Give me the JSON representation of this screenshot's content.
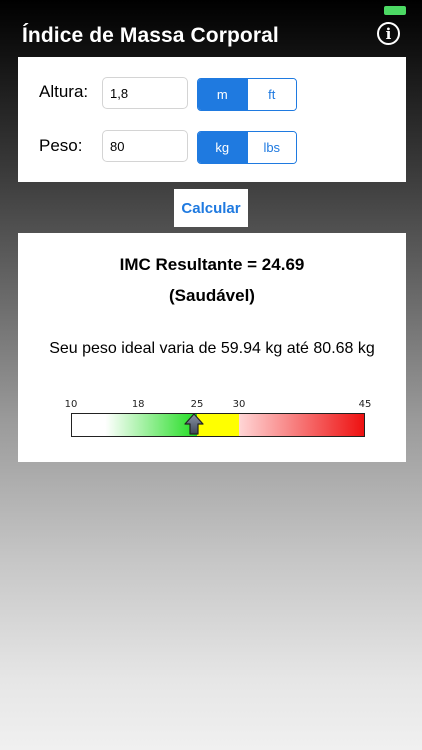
{
  "app": {
    "title": "Índice de Massa Corporal",
    "info_icon": "info-icon",
    "info_glyph": "i"
  },
  "inputs": {
    "height": {
      "label": "Altura:",
      "value": "1,8",
      "units": [
        "m",
        "ft"
      ],
      "selected_unit": "m"
    },
    "weight": {
      "label": "Peso:",
      "value": "80",
      "units": [
        "kg",
        "lbs"
      ],
      "selected_unit": "kg"
    }
  },
  "calculate_label": "Calcular",
  "result": {
    "title": "IMC Resultante = 24.69",
    "status": "(Saudável)",
    "ideal_weight": "Seu peso ideal varia de 59.94 kg até 80.68 kg"
  },
  "scale": {
    "min": 10,
    "max": 45,
    "ticks": [
      "10",
      "18",
      "25",
      "30",
      "45"
    ],
    "marker_value": 24.69,
    "marker_icon": "pointer-arrow-icon"
  },
  "colors": {
    "accent": "#1f7ae0",
    "battery": "#4cd964",
    "scale_green": "#22dd22",
    "scale_yellow": "#ffff00",
    "scale_red": "#ee1111"
  }
}
